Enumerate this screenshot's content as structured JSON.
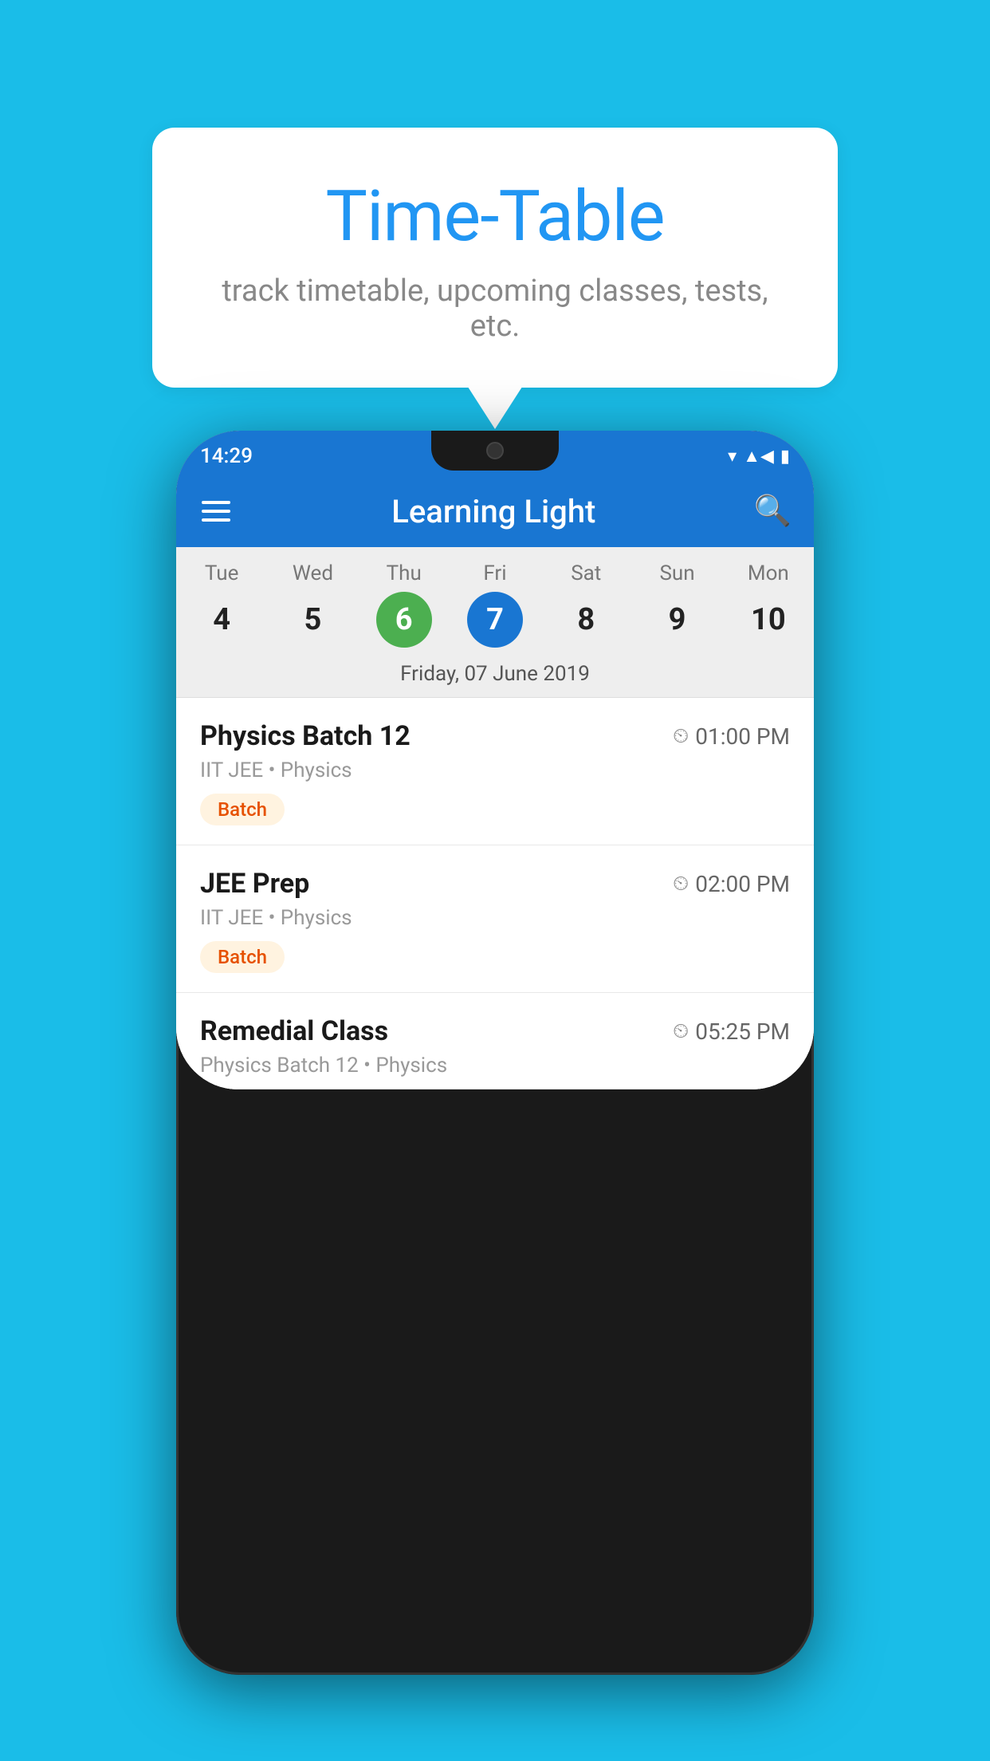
{
  "page": {
    "background_color": "#1ABDE8"
  },
  "speech_bubble": {
    "title": "Time-Table",
    "subtitle": "track timetable, upcoming classes, tests, etc."
  },
  "status_bar": {
    "time": "14:29"
  },
  "app_bar": {
    "title": "Learning Light"
  },
  "calendar": {
    "selected_date_label": "Friday, 07 June 2019",
    "days": [
      {
        "label": "Tue",
        "number": "4",
        "state": "normal"
      },
      {
        "label": "Wed",
        "number": "5",
        "state": "normal"
      },
      {
        "label": "Thu",
        "number": "6",
        "state": "today"
      },
      {
        "label": "Fri",
        "number": "7",
        "state": "selected"
      },
      {
        "label": "Sat",
        "number": "8",
        "state": "normal"
      },
      {
        "label": "Sun",
        "number": "9",
        "state": "normal"
      },
      {
        "label": "Mon",
        "number": "10",
        "state": "normal"
      }
    ]
  },
  "schedule": {
    "items": [
      {
        "title": "Physics Batch 12",
        "time": "01:00 PM",
        "subtitle": "IIT JEE • Physics",
        "badge": "Batch"
      },
      {
        "title": "JEE Prep",
        "time": "02:00 PM",
        "subtitle": "IIT JEE • Physics",
        "badge": "Batch"
      },
      {
        "title": "Remedial Class",
        "time": "05:25 PM",
        "subtitle": "Physics Batch 12 • Physics",
        "badge": null
      }
    ]
  }
}
